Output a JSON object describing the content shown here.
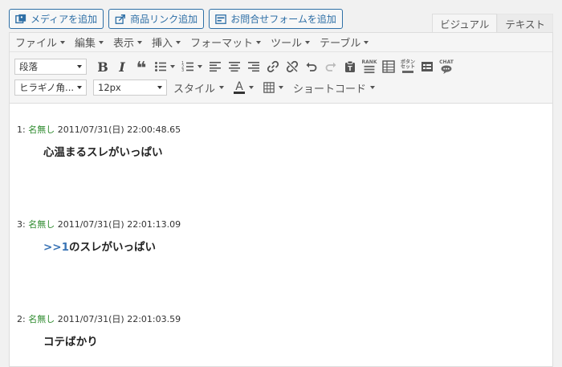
{
  "top_buttons": {
    "media": "メディアを追加",
    "product_link": "商品リンク追加",
    "contact_form": "お問合せフォームを追加"
  },
  "tabs": {
    "visual": "ビジュアル",
    "text": "テキスト"
  },
  "menubar": {
    "file": "ファイル",
    "edit": "編集",
    "view": "表示",
    "insert": "挿入",
    "format": "フォーマット",
    "tools": "ツール",
    "table": "テーブル"
  },
  "toolbar": {
    "paragraph_select": "段落",
    "font_family_select": "ヒラギノ角...",
    "font_size_select": "12px",
    "style_dropdown": "スタイル",
    "shortcode_dropdown": "ショートコード",
    "rank_label": "RANK",
    "button_label": "ボタン\nセット",
    "chat_label": "CHAT"
  },
  "posts": [
    {
      "number": "1:",
      "name": "名無し",
      "datetime": "2011/07/31(日) 22:00:48.65",
      "anchor": "",
      "body": "心温まるスレがいっぱい"
    },
    {
      "number": "3:",
      "name": "名無し",
      "datetime": "2011/07/31(日) 22:01:13.09",
      "anchor": ">>1",
      "body": "のスレがいっぱい"
    },
    {
      "number": "2:",
      "name": "名無し",
      "datetime": "2011/07/31(日) 22:01:03.59",
      "anchor": "",
      "body": "コテばかり"
    }
  ]
}
